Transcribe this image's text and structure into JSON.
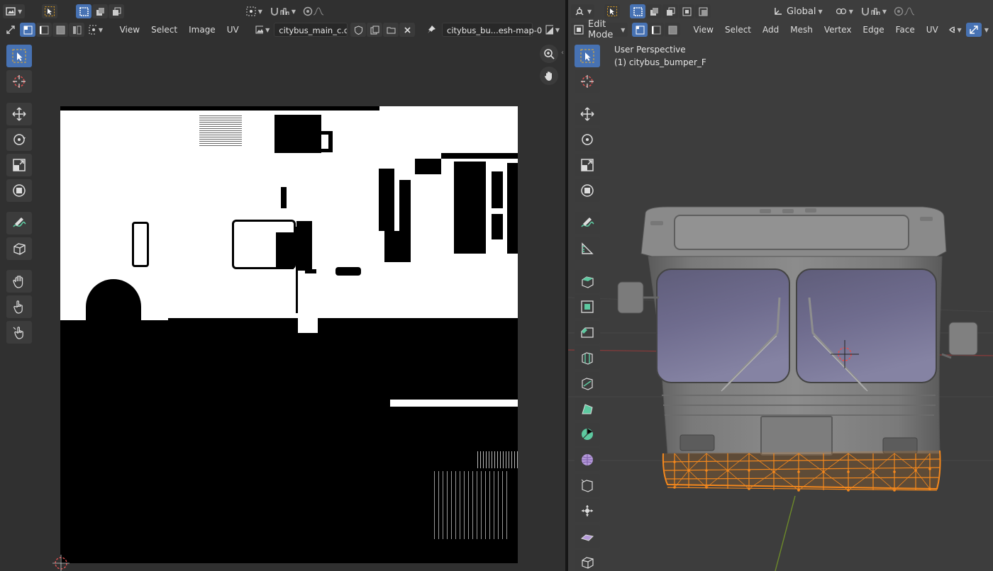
{
  "uv_editor": {
    "header": {
      "menus": [
        "View",
        "Select",
        "Image",
        "UV"
      ],
      "image_name": "citybus_main_c.dat...",
      "uv_map_name": "citybus_bu...esh-map-0"
    }
  },
  "viewport": {
    "header": {
      "transform_orientation": "Global",
      "mode": "Edit Mode",
      "menus": [
        "View",
        "Select",
        "Add",
        "Mesh",
        "Vertex",
        "Edge",
        "Face",
        "UV"
      ]
    },
    "overlay": {
      "view_name": "User Perspective",
      "object_label": "(1) citybus_bumper_F"
    }
  },
  "colors": {
    "selection": "#f5881c",
    "active_tool": "#4772b3",
    "x_axis": "#8b3a3a",
    "y_axis": "#6d8a2a"
  }
}
